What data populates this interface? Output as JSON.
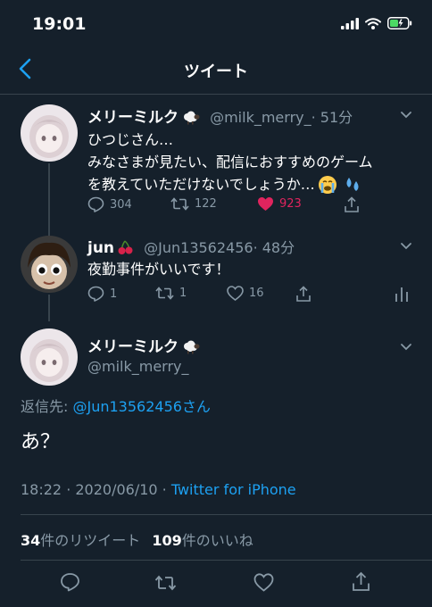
{
  "status_bar": {
    "time": "19:01"
  },
  "nav": {
    "title": "ツイート"
  },
  "reply1": {
    "name": "メリーミルク",
    "handle": "@milk_merry_",
    "time": "· 51分",
    "lines": [
      "ひつじさん…",
      "みなさまが見たい、配信におすすめのゲーム",
      "を教えていただけないでしょうか…"
    ],
    "counts": {
      "reply": "304",
      "retweet": "122",
      "like": "923"
    }
  },
  "reply2": {
    "name": "jun",
    "handle": "@Jun13562456",
    "time": "· 48分",
    "text": "夜勤事件がいいです！",
    "counts": {
      "reply": "1",
      "retweet": "1",
      "like": "16"
    }
  },
  "main_tweet": {
    "name": "メリーミルク",
    "handle": "@milk_merry_",
    "replying_label": "返信先: ",
    "replying_user": "@Jun13562456さん",
    "text": "あ？",
    "timestamp": "18:22 · 2020/06/10 · ",
    "source": "Twitter for iPhone",
    "retweet_count": "34",
    "retweet_label": "件のリツイート",
    "like_count": "109",
    "like_label": "件のいいね"
  },
  "colors": {
    "background": "#15202b",
    "accent": "#1da1f2",
    "muted": "#8899a6",
    "like": "#e0245e",
    "divider": "#38444d"
  },
  "icons": [
    "back-icon",
    "reply-icon",
    "retweet-icon",
    "like-icon",
    "share-icon",
    "analytics-icon",
    "chevron-down-icon",
    "sheep-emoji",
    "cherry-emoji",
    "crying-emoji",
    "sweat-emoji"
  ]
}
